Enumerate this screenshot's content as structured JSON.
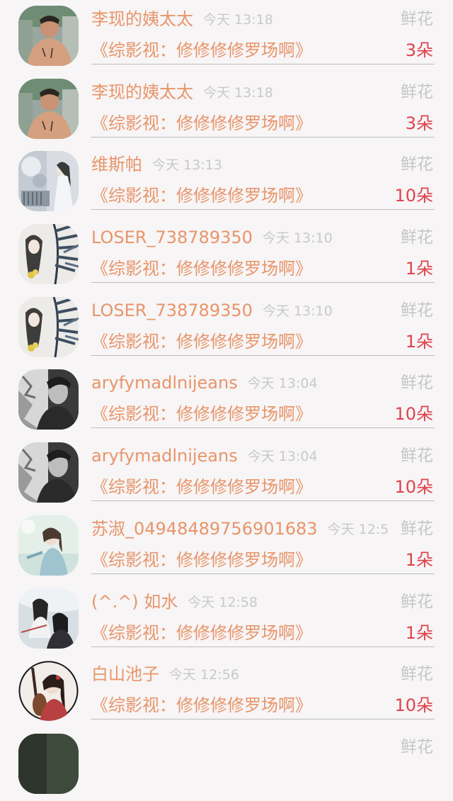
{
  "rows": [
    {
      "name": "李现的姨太太",
      "time": "今天 13:18",
      "gift": "鲜花",
      "title": "《综影视：修修修修罗场啊》",
      "count": "3朵",
      "avatar": "shirtless-man"
    },
    {
      "name": "李现的姨太太",
      "time": "今天 13:18",
      "gift": "鲜花",
      "title": "《综影视：修修修修罗场啊》",
      "count": "3朵",
      "avatar": "shirtless-man"
    },
    {
      "name": "维斯帕",
      "time": "今天 13:13",
      "gift": "鲜花",
      "title": "《综影视：修修修修罗场啊》",
      "count": "10朵",
      "avatar": "white-figure"
    },
    {
      "name": "LOSER_738789350",
      "time": "今天 13:10",
      "gift": "鲜花",
      "title": "《综影视：修修修修罗场啊》",
      "count": "1朵",
      "avatar": "ink-painting"
    },
    {
      "name": "LOSER_738789350",
      "time": "今天 13:10",
      "gift": "鲜花",
      "title": "《综影视：修修修修罗场啊》",
      "count": "1朵",
      "avatar": "ink-painting"
    },
    {
      "name": "aryfymadlnijeans",
      "time": "今天 13:04",
      "gift": "鲜花",
      "title": "《综影视：修修修修罗场啊》",
      "count": "10朵",
      "avatar": "bw-man"
    },
    {
      "name": "aryfymadlnijeans",
      "time": "今天 13:04",
      "gift": "鲜花",
      "title": "《综影视：修修修修罗场啊》",
      "count": "10朵",
      "avatar": "bw-man"
    },
    {
      "name": "苏淑_04948489756901683",
      "time": "今天 12:5",
      "gift": "鲜花",
      "title": "《综影视：修修修修罗场啊》",
      "count": "1朵",
      "avatar": "girl-light"
    },
    {
      "name": "(^.^) 如水",
      "time": "今天 12:58",
      "gift": "鲜花",
      "title": "《综影视：修修修修罗场啊》",
      "count": "1朵",
      "avatar": "two-figures"
    },
    {
      "name": "白山池子",
      "time": "今天 12:56",
      "gift": "鲜花",
      "title": "《综影视：修修修修罗场啊》",
      "count": "10朵",
      "avatar": "pipa-girl"
    },
    {
      "name": "",
      "time": "",
      "gift": "鲜花",
      "title": "",
      "count": "",
      "avatar": "partial"
    }
  ]
}
